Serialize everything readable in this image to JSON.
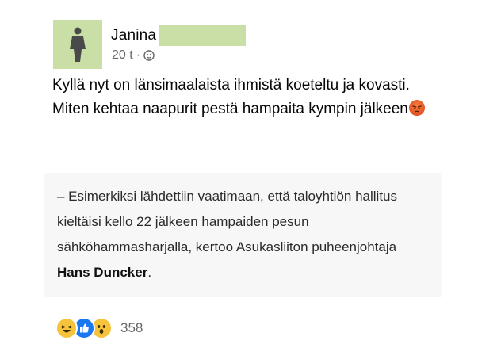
{
  "post": {
    "author": "Janina",
    "time": "20 t",
    "separator": "·",
    "privacy_icon": "globe-icon",
    "avatar_icon": "person-silhouette-icon",
    "lines": [
      "Kyllä nyt on länsimaalaista ihmistä koeteltu ja kovasti.",
      "Miten kehtaa naapurit pestä hampaita kympin jälkeen"
    ],
    "emoji": "angry-face-icon"
  },
  "quote": {
    "text": "– Esimerkiksi lähdettiin vaatimaan, että taloyhtiön hallitus kieltäisi kello 22 jälkeen hampaiden pesun sähköhammasharjalla, kertoo Asukasliiton puheenjohtaja ",
    "bold": "Hans Duncker",
    "end": "."
  },
  "reactions": {
    "icons": [
      "haha-icon",
      "like-icon",
      "wow-icon"
    ],
    "count": "358"
  },
  "colors": {
    "avatar_bg": "#c9dfa6",
    "quote_bg": "#f7f7f7",
    "meta_text": "#65676b"
  }
}
